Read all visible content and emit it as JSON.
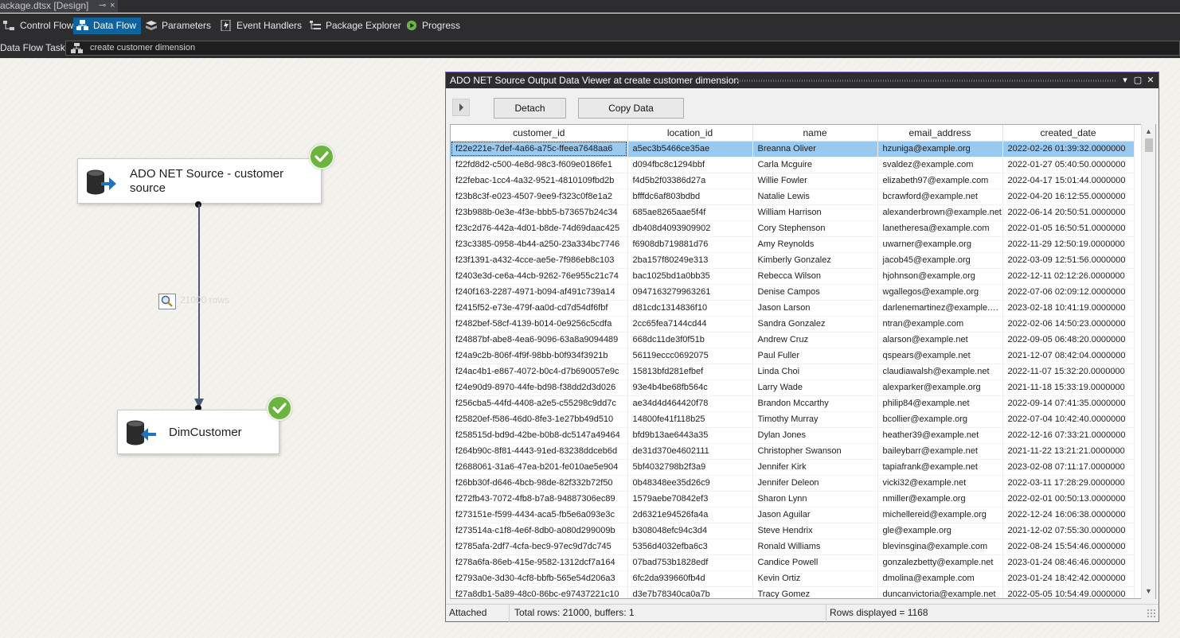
{
  "document_tab": {
    "title": "ackage.dtsx [Design]",
    "pin_glyph": "⊸",
    "close_glyph": "×"
  },
  "designer_tabs": [
    {
      "label": "Control Flow",
      "icon": "control-flow-icon"
    },
    {
      "label": "Data Flow",
      "icon": "data-flow-icon",
      "active": true
    },
    {
      "label": "Parameters",
      "icon": "parameters-icon"
    },
    {
      "label": "Event Handlers",
      "icon": "event-handlers-icon"
    },
    {
      "label": "Package Explorer",
      "icon": "package-explorer-icon"
    },
    {
      "label": "Progress",
      "icon": "progress-play-icon"
    }
  ],
  "task_bar": {
    "label": "Data Flow Task:",
    "selected_task": "create customer dimension"
  },
  "components": {
    "source": {
      "name_line1": "ADO NET Source - customer",
      "name_line2": "source",
      "status": "success"
    },
    "destination": {
      "name": "DimCustomer",
      "status": "success"
    },
    "path_label": "21000 rows"
  },
  "viewer": {
    "title": "ADO NET Source Output Data Viewer at create customer dimension",
    "detach_label": "Detach",
    "copy_label": "Copy Data",
    "columns": [
      "customer_id",
      "location_id",
      "name",
      "email_address",
      "created_date"
    ],
    "rows": [
      [
        "f22e221e-7def-4a66-a75c-ffeea7648aa6",
        "a5ec3b5466ce35ae",
        "Breanna Oliver",
        "hzuniga@example.org",
        "2022-02-26 01:39:32.0000000"
      ],
      [
        "f22fd8d2-c500-4e8d-98c3-f609e0186fe1",
        "d094fbc8c1294bbf",
        "Carla Mcguire",
        "svaldez@example.com",
        "2022-01-27 05:40:50.0000000"
      ],
      [
        "f22febac-1cc4-4a32-9521-4810109fbd2b",
        "f4d5b2f03386d27a",
        "Willie Fowler",
        "elizabeth97@example.com",
        "2022-04-17 15:01:44.0000000"
      ],
      [
        "f23b8c3f-e023-4507-9ee9-f323c0f8e1a2",
        "bfffdc6af803bdbd",
        "Natalie Lewis",
        "bcrawford@example.net",
        "2022-04-20 16:12:55.0000000"
      ],
      [
        "f23b988b-0e3e-4f3e-bbb5-b73657b24c34",
        "685ae8265aae5f4f",
        "William Harrison",
        "alexanderbrown@example.net",
        "2022-06-14 20:50:51.0000000"
      ],
      [
        "f23c2d76-442a-4d01-b8de-74d69daac425",
        "db408d4093909902",
        "Cory Stephenson",
        "lanetheresa@example.com",
        "2022-01-05 16:50:51.0000000"
      ],
      [
        "f23c3385-0958-4b44-a250-23a334bc7746",
        "f6908db719881d76",
        "Amy Reynolds",
        "uwarner@example.org",
        "2022-11-29 12:50:19.0000000"
      ],
      [
        "f23f1391-a432-4cce-ae5e-7f986eb8c103",
        "2ba157f80249e313",
        "Kimberly Gonzalez",
        "jacob45@example.org",
        "2022-03-09 12:51:56.0000000"
      ],
      [
        "f2403e3d-ce6a-44cb-9262-76e955c21c74",
        "bac1025bd1a0bb35",
        "Rebecca Wilson",
        "hjohnson@example.org",
        "2022-12-11 02:12:26.0000000"
      ],
      [
        "f240f163-2287-4971-b094-af491c739a14",
        "0947163279963261",
        "Denise Campos",
        "wgallegos@example.org",
        "2022-07-06 02:09:12.0000000"
      ],
      [
        "f2415f52-e73e-479f-aa0d-cd7d54df6fbf",
        "d81cdc1314836f10",
        "Jason Larson",
        "darlenemartinez@example.com",
        "2023-02-18 10:41:19.0000000"
      ],
      [
        "f2482bef-58cf-4139-b014-0e9256c5cdfa",
        "2cc65fea7144cd44",
        "Sandra Gonzalez",
        "ntran@example.com",
        "2022-02-06 14:50:23.0000000"
      ],
      [
        "f24887bf-abe8-4ea6-9096-63a8a9094489",
        "668dc11de3f0f51b",
        "Andrew Cruz",
        "alarson@example.net",
        "2022-09-05 06:48:20.0000000"
      ],
      [
        "f24a9c2b-806f-4f9f-98bb-b0f934f3921b",
        "56119eccc0692075",
        "Paul Fuller",
        "qspears@example.net",
        "2021-12-07 08:42:04.0000000"
      ],
      [
        "f24ac4b1-e867-4072-b0c4-d7b690057e9c",
        "15813bfd281efbef",
        "Linda Choi",
        "claudiawalsh@example.net",
        "2022-11-07 15:32:20.0000000"
      ],
      [
        "f24e90d9-8970-44fe-bd98-f38dd2d3d026",
        "93e4b4be68fb564c",
        "Larry Wade",
        "alexparker@example.org",
        "2021-11-18 15:33:19.0000000"
      ],
      [
        "f256cba5-44fd-4408-a2e5-c55298c9dd7c",
        "ae34d4d464420f78",
        "Brandon Mccarthy",
        "philip84@example.net",
        "2022-09-14 07:41:35.0000000"
      ],
      [
        "f25820ef-f586-46d0-8fe3-1e27bb49d510",
        "14800fe41f118b25",
        "Timothy Murray",
        "bcollier@example.org",
        "2022-07-04 10:42:40.0000000"
      ],
      [
        "f258515d-bd9d-42be-b0b8-dc5147a49464",
        "bfd9b13ae6443a35",
        "Dylan Jones",
        "heather39@example.net",
        "2022-12-16 07:33:21.0000000"
      ],
      [
        "f264b90c-8f81-4443-91ed-83238ddceb6d",
        "de31d370e4602111",
        "Christopher Swanson",
        "baileybarr@example.net",
        "2021-11-22 13:21:21.0000000"
      ],
      [
        "f2688061-31a6-47ea-b201-fe010ae5e904",
        "5bf4032798b2f3a9",
        "Jennifer Kirk",
        "tapiafrank@example.net",
        "2023-02-08 07:11:17.0000000"
      ],
      [
        "f26bb30f-d646-4bcb-98de-82f332b72f50",
        "0b48348ee35d26c9",
        "Jennifer Deleon",
        "vicki32@example.net",
        "2022-03-11 17:28:29.0000000"
      ],
      [
        "f272fb43-7072-4fb8-b7a8-94887306ec89",
        "1579aebe70842ef3",
        "Sharon Lynn",
        "nmiller@example.org",
        "2022-02-01 00:50:13.0000000"
      ],
      [
        "f273151e-f599-4434-aca5-fb5e6a093e3c",
        "2d6321e94526fa4a",
        "Jason Aguilar",
        "michellereid@example.org",
        "2022-12-24 16:06:38.0000000"
      ],
      [
        "f273514a-c1f8-4e6f-8db0-a080d299009b",
        "b308048efc94c3d4",
        "Steve Hendrix",
        "gle@example.org",
        "2021-12-02 07:55:30.0000000"
      ],
      [
        "f2785afa-2df7-4cfa-bec9-97ec9d7dc745",
        "5356d4032efba6c3",
        "Ronald Williams",
        "blevinsgina@example.com",
        "2022-08-24 15:54:46.0000000"
      ],
      [
        "f278a6fa-86eb-415e-9582-1312dcf7a164",
        "07bad753b1828edf",
        "Candice Powell",
        "gonzalezbetty@example.net",
        "2023-01-24 08:46:46.0000000"
      ],
      [
        "f2793a0e-3d30-4cf8-bbfb-565e54d206a3",
        "6fc2da939660fb4d",
        "Kevin Ortiz",
        "dmolina@example.com",
        "2023-01-24 18:42:42.0000000"
      ],
      [
        "f27a8db1-5a89-48c0-86bc-e97437221c10",
        "d3e7b78340ca0a7b",
        "Tracy Gomez",
        "duncanvictoria@example.net",
        "2022-05-05 10:54:49.0000000"
      ]
    ],
    "status": {
      "attached": "Attached",
      "total": "Total rows: 21000, buffers: 1",
      "displayed": "Rows displayed = 1168"
    }
  }
}
